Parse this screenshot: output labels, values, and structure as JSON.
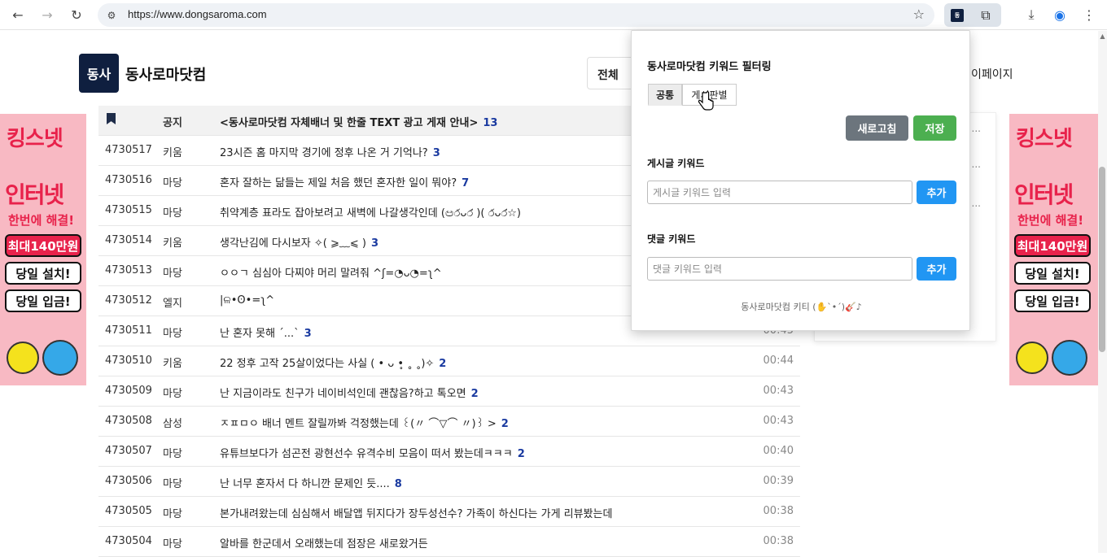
{
  "browser": {
    "url": "https://www.dongsaroma.com"
  },
  "site": {
    "logo_text": "동사",
    "name": "동사로마닷컴",
    "select_value": "전체",
    "mypage_label": "이페이지"
  },
  "ad": {
    "brand": "킹스넷",
    "headline": "인터넷",
    "sub": "한번에 해결!",
    "pill1": "최대140만원",
    "pill2": "당일 설치!",
    "pill3": "당일 입금!"
  },
  "board": {
    "notice": {
      "category": "공지",
      "title": "<동사로마닷컴 자체배너 및 한줄 TEXT 광고 게재 안내>",
      "count": "13"
    },
    "rows": [
      {
        "num": "4730517",
        "category": "키움",
        "title": "23시즌 홈 마지막 경기에 정후 나온 거 기억나?",
        "count": "3",
        "time": ""
      },
      {
        "num": "4730516",
        "category": "마당",
        "title": "혼자 잘하는 닮들는 제일 처음 했던 혼자한 일이 뭐야?",
        "count": "7",
        "time": ""
      },
      {
        "num": "4730515",
        "category": "마당",
        "title": "취약계층 표라도 잡아보려고 새벽에 나갈생각인데 (ඏර̀ᴗර́ )( ර̀ᴗර́☆)",
        "count": "",
        "time": ""
      },
      {
        "num": "4730514",
        "category": "키움",
        "title": "생각난김에 다시보자 ✧( ⩾﹏⩽ )",
        "count": "3",
        "time": ""
      },
      {
        "num": "4730513",
        "category": "마당",
        "title": "ㅇㅇㄱ 심심아 다찌야 머리 말려줘 ^ʃ=◔ᴗ◔=ʅ^",
        "count": "",
        "time": ""
      },
      {
        "num": "4730512",
        "category": "엘지",
        "title": "|ଳ•ʘ•=ʅ^",
        "count": "",
        "time": ""
      },
      {
        "num": "4730511",
        "category": "마당",
        "title": "난 혼자 못해 ´...`",
        "count": "3",
        "time": "00:45"
      },
      {
        "num": "4730510",
        "category": "키움",
        "title": "22 정후 고작 25살이었다는 사실 ( • ᴗ •̥ ˳ ˳)✧",
        "count": "2",
        "time": "00:44"
      },
      {
        "num": "4730509",
        "category": "마당",
        "title": "난 지금이라도 친구가 네이비석인데 괜찮음?하고 톡오면",
        "count": "2",
        "time": "00:43"
      },
      {
        "num": "4730508",
        "category": "삼성",
        "title": "ㅈㅍㅁㅇ 배너 멘트 잘릴까봐 걱정했는데 ꒰(〃 ⌒▽⌒ 〃)꒱ >",
        "count": "2",
        "time": "00:43"
      },
      {
        "num": "4730507",
        "category": "마당",
        "title": "유튜브보다가 섬곤전 광현선수 유격수비 모음이 떠서 봤는데ㅋㅋㅋ",
        "count": "2",
        "time": "00:40"
      },
      {
        "num": "4730506",
        "category": "마당",
        "title": "난 너무 혼자서 다 하니깐 문제인 듯....",
        "count": "8",
        "time": "00:39"
      },
      {
        "num": "4730505",
        "category": "마당",
        "title": "본가내려왔는데 심심해서 배달앱 뒤지다가 장두성선수? 가족이 하신다는 가게 리뷰봤는데",
        "count": "",
        "time": "00:38"
      },
      {
        "num": "4730504",
        "category": "마당",
        "title": "알바를 한군데서 오래했는데 점장은 새로왔거든",
        "count": "",
        "time": "00:38"
      }
    ]
  },
  "popup": {
    "title": "동사로마닷컴 키워드 필터링",
    "tab_common": "공통",
    "tab_board": "게시판별",
    "refresh_label": "새로고침",
    "save_label": "저장",
    "post_keyword_label": "게시글 키워드",
    "post_keyword_placeholder": "게시글 키워드 입력",
    "comment_keyword_label": "댓글 키워드",
    "comment_keyword_placeholder": "댓글 키워드 입력",
    "add_label": "추가",
    "footer": "동사로마닷컴 키티 (✋`•´)🎸♪"
  },
  "icons": {
    "back": "back-arrow-icon",
    "forward": "forward-arrow-icon",
    "reload": "reload-icon",
    "bookmark": "star-icon",
    "extensions": "puzzle-icon",
    "download": "download-icon",
    "profile": "profile-icon",
    "menu": "kebab-menu-icon"
  }
}
